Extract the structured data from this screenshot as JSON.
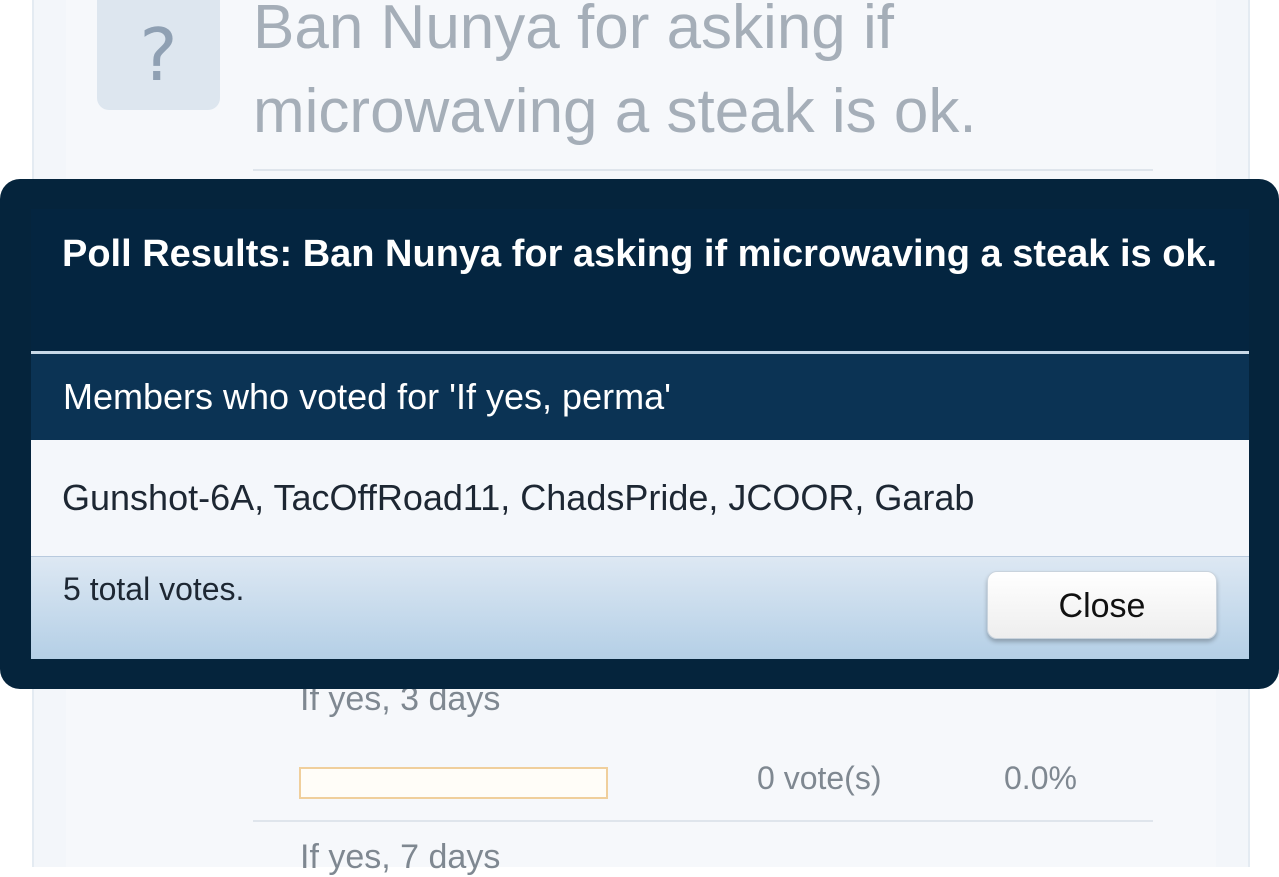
{
  "background": {
    "thread_title": "Ban Nunya for asking if microwaving a steak is ok.",
    "question_icon": "?",
    "options": [
      {
        "label": "If yes, 3 days",
        "votes": "0 vote(s)",
        "percent": "0.0%"
      },
      {
        "label": "If yes, 7 days"
      }
    ]
  },
  "modal": {
    "title": "Poll Results: Ban Nunya for asking if microwaving a steak is ok.",
    "subheader": "Members who voted for 'If yes, perma'",
    "voters": "Gunshot-6A, TacOffRoad11, ChadsPride, JCOOR, Garab",
    "total": "5 total votes.",
    "close_label": "Close"
  },
  "colors": {
    "modal_dark": "#042540",
    "subheader": "#0b3354",
    "footer_light": "#dde8f3"
  }
}
